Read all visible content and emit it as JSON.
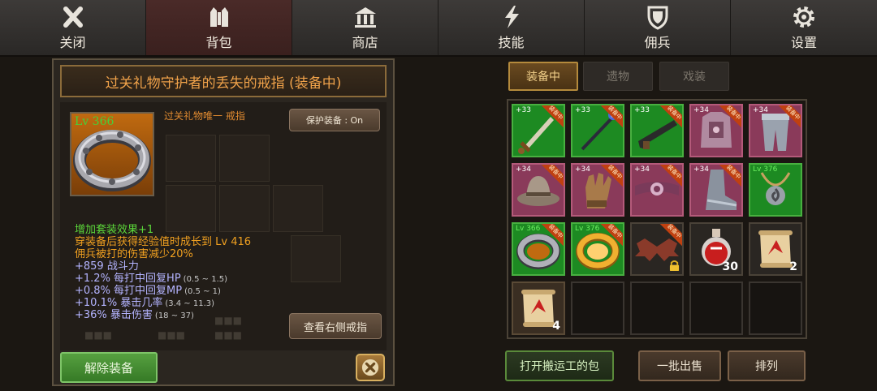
{
  "nav": {
    "tabs": [
      {
        "label": "关闭",
        "icon": "close-icon"
      },
      {
        "label": "背包",
        "icon": "backpack-icon"
      },
      {
        "label": "商店",
        "icon": "shop-icon"
      },
      {
        "label": "技能",
        "icon": "skill-icon"
      },
      {
        "label": "佣兵",
        "icon": "shield-icon"
      },
      {
        "label": "设置",
        "icon": "gear-icon"
      }
    ],
    "active": "背包"
  },
  "item": {
    "title": "过关礼物守护者的丢失的戒指 (装备中)",
    "level": "Lv 366",
    "subtitle": "过关礼物唯一 戒指",
    "protect_label": "保护装备 : On",
    "view_right_ring": "查看右侧戒指",
    "unequip": "解除装备",
    "stats": [
      {
        "text": "增加套装效果+1",
        "range": "",
        "color": "#5cd83a"
      },
      {
        "text": "穿装备后获得经验值时成长到 Lv 416",
        "range": "",
        "color": "#f0a020"
      },
      {
        "text": "佣兵被打的伤害减少20%",
        "range": "",
        "color": "#f0a020"
      },
      {
        "text": "+859 战斗力",
        "range": "",
        "color": "#b4b4ff"
      },
      {
        "text": "+1.2% 每打中回复HP",
        "range": "(0.5 ~ 1.5)",
        "color": "#b4b4ff"
      },
      {
        "text": "+0.8% 每打中回复MP",
        "range": "(0.5 ~ 1)",
        "color": "#b4b4ff"
      },
      {
        "text": "+10.1% 暴击几率",
        "range": "(3.4 ~ 11.3)",
        "color": "#b4b4ff"
      },
      {
        "text": "+36% 暴击伤害",
        "range": "(18 ~ 37)",
        "color": "#b4b4ff"
      }
    ]
  },
  "inventory": {
    "tabs": [
      "装备中",
      "遗物",
      "戏装"
    ],
    "active_tab": "装备中",
    "equipped_badge": "装备中",
    "slots": [
      {
        "bg": "green",
        "tag": "+33",
        "equipped": true,
        "icon": "sword-icon"
      },
      {
        "bg": "green",
        "tag": "+33",
        "equipped": true,
        "icon": "staff-icon"
      },
      {
        "bg": "green",
        "tag": "+33",
        "equipped": true,
        "icon": "gun-icon"
      },
      {
        "bg": "pink",
        "tag": "+34",
        "equipped": true,
        "icon": "chest-armor-icon"
      },
      {
        "bg": "pink",
        "tag": "+34",
        "equipped": true,
        "icon": "leg-armor-icon"
      },
      {
        "bg": "pink",
        "tag": "+34",
        "equipped": true,
        "icon": "hat-icon"
      },
      {
        "bg": "pink",
        "tag": "+34",
        "equipped": true,
        "icon": "glove-icon"
      },
      {
        "bg": "pink",
        "tag": "+34",
        "equipped": true,
        "icon": "belt-icon"
      },
      {
        "bg": "pink",
        "tag": "+34",
        "equipped": true,
        "icon": "boot-icon"
      },
      {
        "bg": "green",
        "tag": "Lv 376",
        "equipped": false,
        "icon": "necklace-icon"
      },
      {
        "bg": "green",
        "tag": "Lv 366",
        "equipped": true,
        "icon": "silver-ring-icon"
      },
      {
        "bg": "green",
        "tag": "Lv 376",
        "equipped": true,
        "icon": "gold-ring-icon"
      },
      {
        "bg": "dark",
        "tag": "",
        "equipped": true,
        "icon": "bat-wings-icon",
        "locked": true
      },
      {
        "bg": "dark",
        "tag": "",
        "equipped": false,
        "icon": "potion-icon",
        "qty": "30"
      },
      {
        "bg": "dark",
        "tag": "",
        "equipped": false,
        "icon": "scroll-icon",
        "qty": "2"
      },
      {
        "bg": "brown",
        "tag": "",
        "equipped": false,
        "icon": "scroll-icon",
        "qty": "4"
      },
      {
        "bg": "empty"
      },
      {
        "bg": "empty"
      },
      {
        "bg": "empty"
      },
      {
        "bg": "empty"
      }
    ]
  },
  "bottom": {
    "open_bag": "打开搬运工的包",
    "bulk_sell": "一批出售",
    "sort": "排列"
  }
}
